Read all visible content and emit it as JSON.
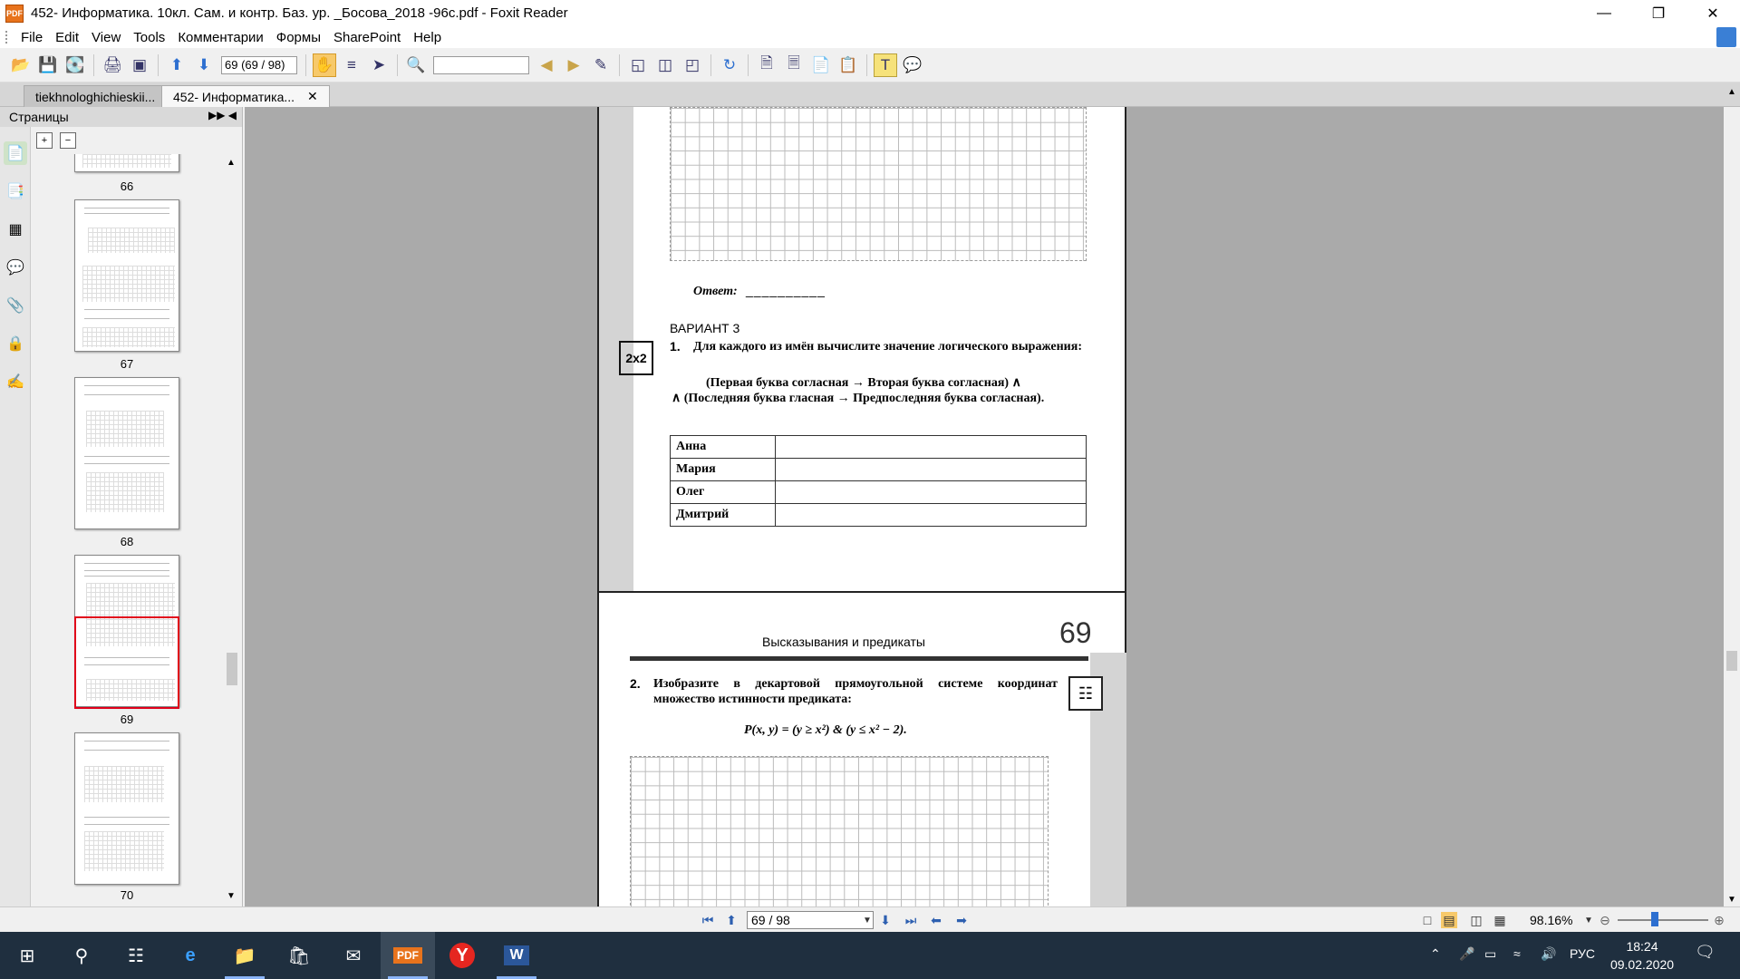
{
  "window": {
    "title": "452- Информатика. 10кл. Сам. и контр. Баз. ур. _Босова_2018 -96с.pdf - Foxit Reader",
    "app_icon_text": "PDF"
  },
  "menu": [
    "File",
    "Edit",
    "View",
    "Tools",
    "Комментарии",
    "Формы",
    "SharePoint",
    "Help"
  ],
  "toolbar": {
    "page_value": "69 (69 / 98)"
  },
  "tabs": [
    {
      "label": "tiekhnologhichieskii...",
      "active": false
    },
    {
      "label": "452- Информатика...",
      "active": true
    }
  ],
  "left_panel": {
    "title": "Страницы",
    "thumbnails": [
      {
        "label": "66"
      },
      {
        "label": "67"
      },
      {
        "label": "68"
      },
      {
        "label": "69",
        "selected": true
      },
      {
        "label": "70"
      }
    ]
  },
  "page68": {
    "answer_label": "Ответ:",
    "answer_blank": "__________",
    "variant": "ВАРИАНТ 3",
    "task1_tag": "2x2",
    "task1_num": "1.",
    "task1_text": "Для каждого из имён вычислите значение логического выражения:",
    "formula_line1": "(Первая буква согласная → Вторая буква согласная) ∧",
    "formula_line2": "∧ (Последняя буква гласная → Предпоследняя буква согласная).",
    "names": [
      "Анна",
      "Мария",
      "Олег",
      "Дмитрий"
    ]
  },
  "page69": {
    "header": "Высказывания и предикаты",
    "page_number": "69",
    "task2_num": "2.",
    "task2_text": "Изобразите в декартовой прямоугольной системе координат множество истинности предиката:",
    "formula": "P(x, y) = (y ≥ x²) & (y ≤ x² − 2)."
  },
  "statusbar": {
    "page": "69 / 98",
    "zoom": "98.16%"
  },
  "taskbar": {
    "lang": "РУС",
    "time": "18:24",
    "date": "09.02.2020"
  }
}
